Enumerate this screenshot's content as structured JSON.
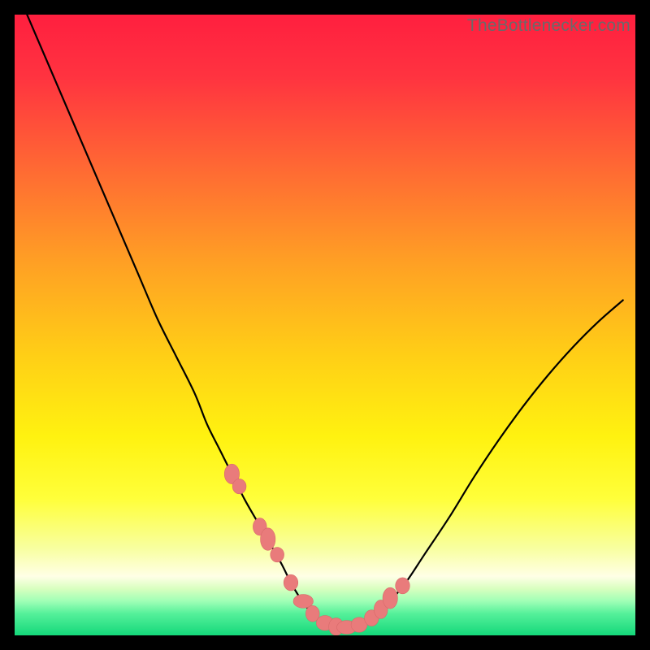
{
  "watermark": {
    "text": "TheBottlenecker.com"
  },
  "colors": {
    "gradient_stops": [
      {
        "offset": 0.0,
        "color": "#ff1f3f"
      },
      {
        "offset": 0.1,
        "color": "#ff3340"
      },
      {
        "offset": 0.25,
        "color": "#ff6a33"
      },
      {
        "offset": 0.4,
        "color": "#ffa024"
      },
      {
        "offset": 0.55,
        "color": "#ffcf16"
      },
      {
        "offset": 0.68,
        "color": "#fff210"
      },
      {
        "offset": 0.78,
        "color": "#ffff3a"
      },
      {
        "offset": 0.86,
        "color": "#f8ffa0"
      },
      {
        "offset": 0.905,
        "color": "#ffffe6"
      },
      {
        "offset": 0.925,
        "color": "#d8ffbf"
      },
      {
        "offset": 0.945,
        "color": "#9fffb6"
      },
      {
        "offset": 0.965,
        "color": "#55f09a"
      },
      {
        "offset": 1.0,
        "color": "#14d87a"
      }
    ],
    "curve": "#000000",
    "marker_fill": "#e97b7b",
    "marker_stroke": "#d86a6a"
  },
  "chart_data": {
    "type": "line",
    "title": "",
    "xlabel": "",
    "ylabel": "",
    "xlim": [
      0,
      100
    ],
    "ylim": [
      0,
      100
    ],
    "series": [
      {
        "name": "bottleneck-curve",
        "x": [
          2,
          5,
          8,
          11,
          14,
          17,
          20,
          23,
          26,
          29,
          31,
          33,
          35,
          37,
          39,
          41,
          43,
          44.5,
          46,
          47.5,
          49,
          51,
          53,
          55,
          57.5,
          60,
          63,
          66,
          70,
          74,
          78,
          82,
          86,
          90,
          94,
          98
        ],
        "values": [
          100,
          93,
          86,
          79,
          72,
          65,
          58,
          51,
          45,
          39,
          34,
          30,
          26,
          22,
          18.5,
          15,
          11.5,
          8.5,
          6,
          4,
          2.5,
          1.6,
          1.3,
          1.6,
          2.8,
          5,
          8.5,
          13,
          19,
          25.5,
          31.5,
          37,
          42,
          46.5,
          50.5,
          54
        ]
      }
    ],
    "markers": {
      "name": "highlight-points",
      "x": [
        35,
        36.2,
        39.5,
        40.8,
        42.3,
        44.5,
        46.5,
        48.0,
        50.0,
        51.8,
        53.5,
        55.5,
        57.5,
        59.0,
        60.5,
        62.5
      ],
      "values": [
        26.0,
        24.0,
        17.5,
        15.5,
        13.0,
        8.5,
        5.5,
        3.5,
        2.0,
        1.4,
        1.3,
        1.7,
        2.8,
        4.2,
        6.0,
        8.0
      ],
      "rx": [
        1.2,
        1.1,
        1.1,
        1.2,
        1.1,
        1.15,
        1.6,
        1.1,
        1.4,
        1.2,
        1.6,
        1.3,
        1.15,
        1.1,
        1.2,
        1.15
      ],
      "ry": [
        1.6,
        1.2,
        1.4,
        1.8,
        1.2,
        1.3,
        1.1,
        1.3,
        1.2,
        1.4,
        1.1,
        1.2,
        1.3,
        1.5,
        1.7,
        1.3
      ]
    }
  }
}
